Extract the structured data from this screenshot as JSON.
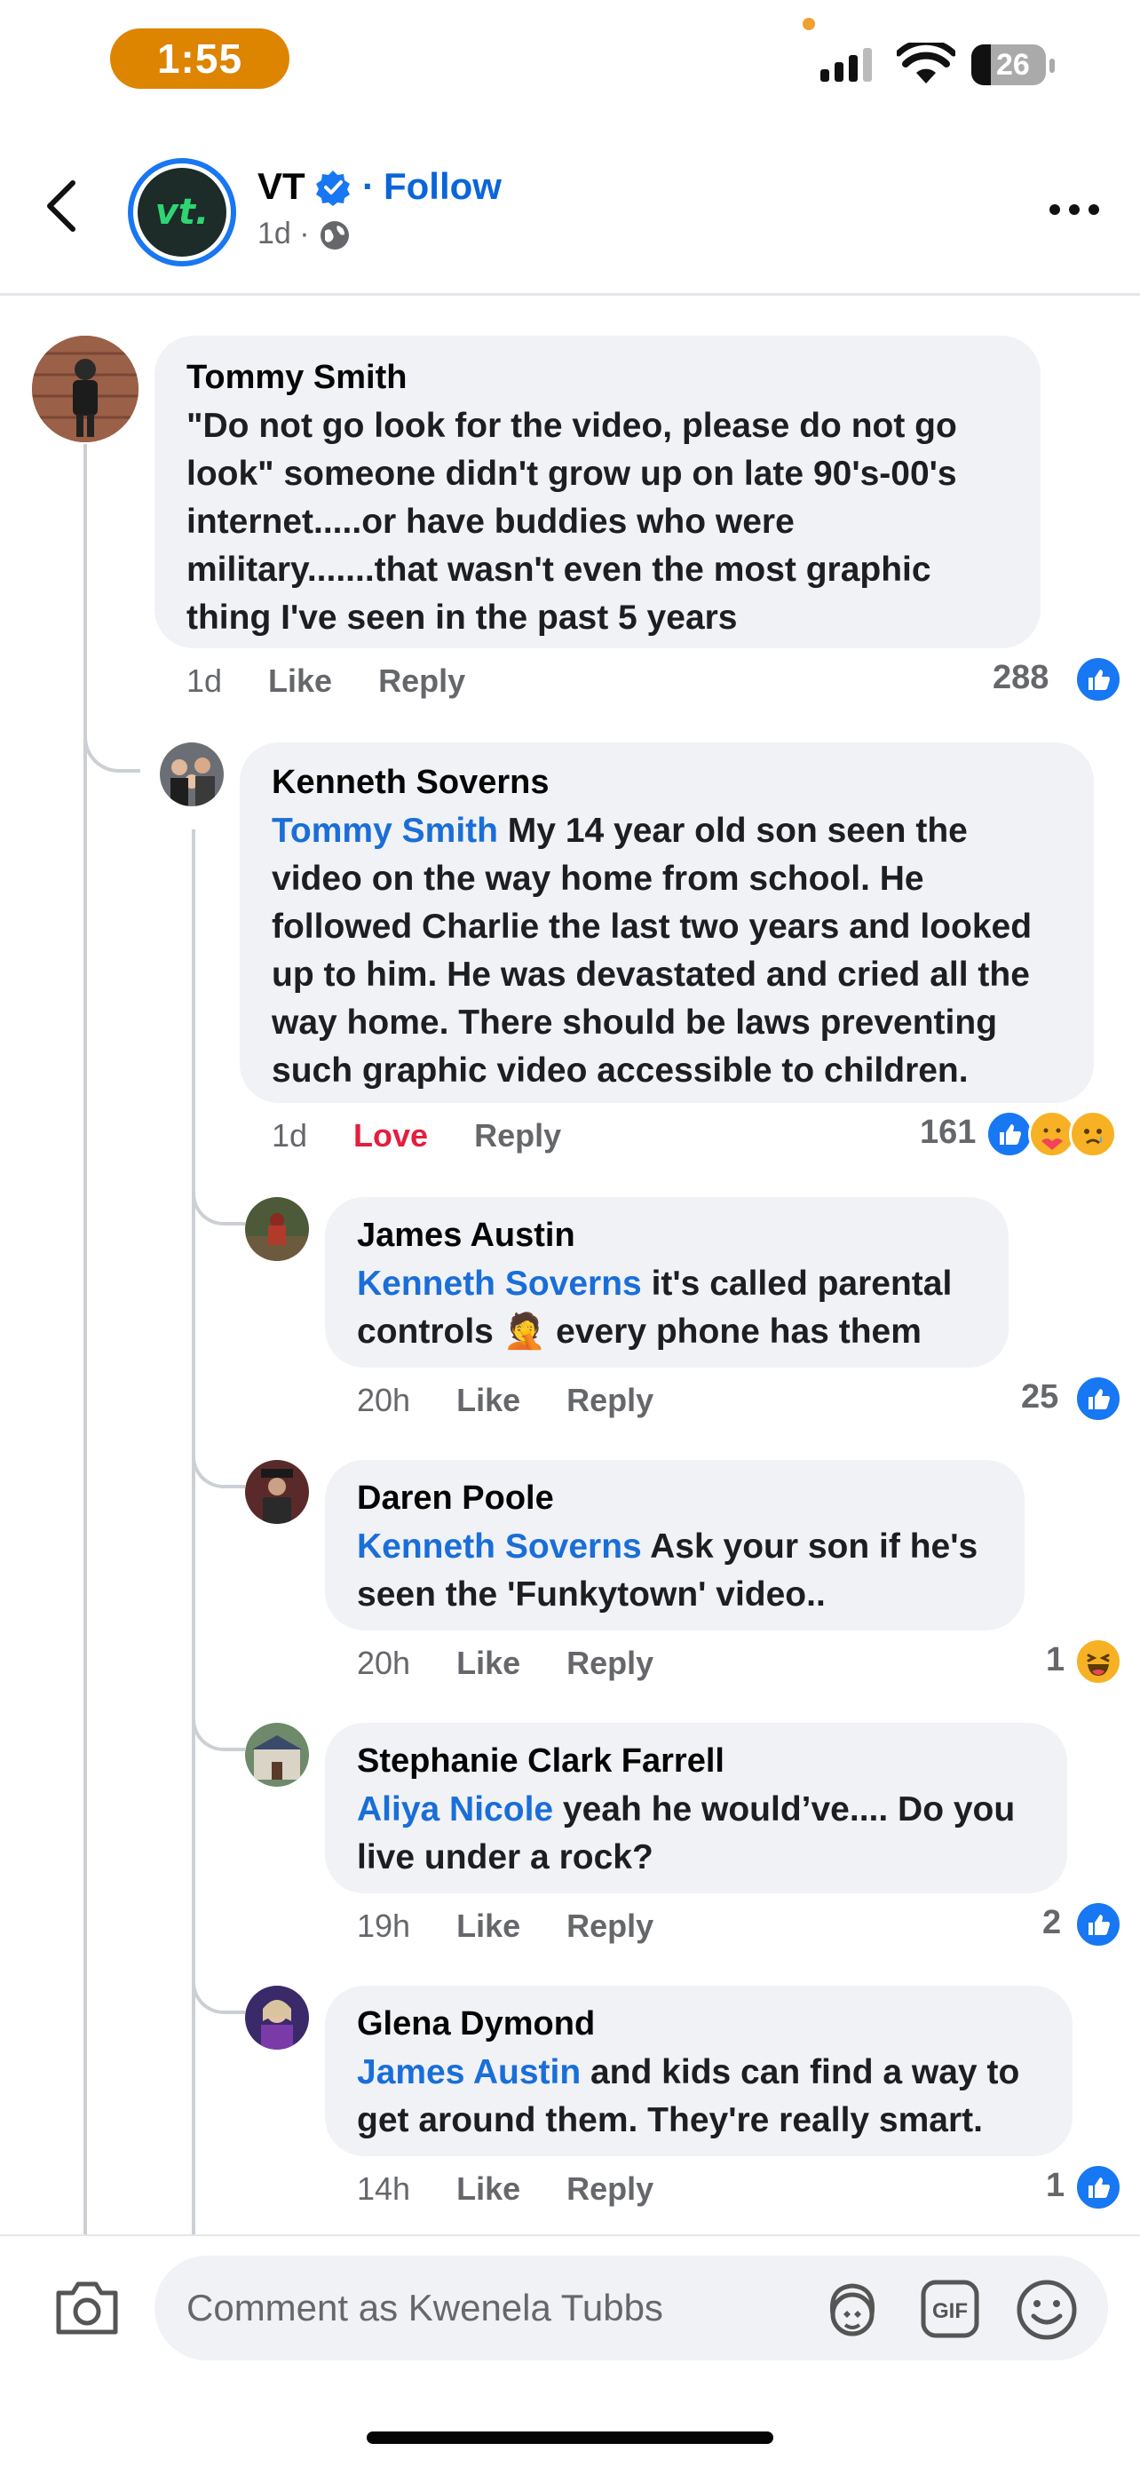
{
  "status_bar": {
    "time": "1:55",
    "battery": "26"
  },
  "header": {
    "page_name": "VT",
    "avatar_text": "vt.",
    "separator": "·",
    "follow_label": "Follow",
    "post_age": "1d ·"
  },
  "comments": [
    {
      "author": "Tommy Smith",
      "text": "\"Do not go look for the video, please do not go look\" someone didn't grow up on late 90's-00's internet.....or have buddies who were military.......that wasn't even the most graphic thing I've seen in the past 5 years",
      "time": "1d",
      "action": "Like",
      "reply": "Reply",
      "count": "288"
    },
    {
      "author": "Kenneth Soverns",
      "mention": "Tommy Smith",
      "text": " My 14 year old son seen the video on the way home from school. He followed Charlie the last two years and looked up to him. He was devastated and cried all the way home. There should be laws preventing such graphic video accessible to children.",
      "time": "1d",
      "action": "Love",
      "reply": "Reply",
      "count": "161"
    },
    {
      "author": "James Austin",
      "mention": "Kenneth Soverns",
      "text": " it's called parental controls 🤦 every phone has them",
      "time": "20h",
      "action": "Like",
      "reply": "Reply",
      "count": "25"
    },
    {
      "author": "Daren Poole",
      "mention": "Kenneth Soverns",
      "text": " Ask your son if he's seen the 'Funkytown' video..",
      "time": "20h",
      "action": "Like",
      "reply": "Reply",
      "count": "1"
    },
    {
      "author": "Stephanie Clark Farrell",
      "mention": "Aliya Nicole",
      "text": " yeah he would’ve.... Do you live under a rock?",
      "time": "19h",
      "action": "Like",
      "reply": "Reply",
      "count": "2"
    },
    {
      "author": "Glena Dymond",
      "mention": "James Austin",
      "text": " and kids can find a way to get around them. They're really smart.",
      "time": "14h",
      "action": "Like",
      "reply": "Reply",
      "count": "1"
    }
  ],
  "composer": {
    "placeholder": "Comment as Kwenela Tubbs"
  },
  "icons": {
    "back": "back-arrow-icon",
    "verified": "verified-badge-icon",
    "globe": "globe-icon",
    "more": "more-icon",
    "like": "like-icon",
    "love": "care-reaction-icon",
    "sad": "sad-reaction-icon",
    "haha": "haha-reaction-icon",
    "camera": "camera-icon",
    "avatar_sticker": "avatar-sticker-icon",
    "gif": "gif-icon",
    "emoji": "emoji-icon"
  },
  "colors": {
    "accent": "#1877f2",
    "link": "#1a6ed8",
    "love": "#e41e3f",
    "time_pill": "#dd8400"
  }
}
